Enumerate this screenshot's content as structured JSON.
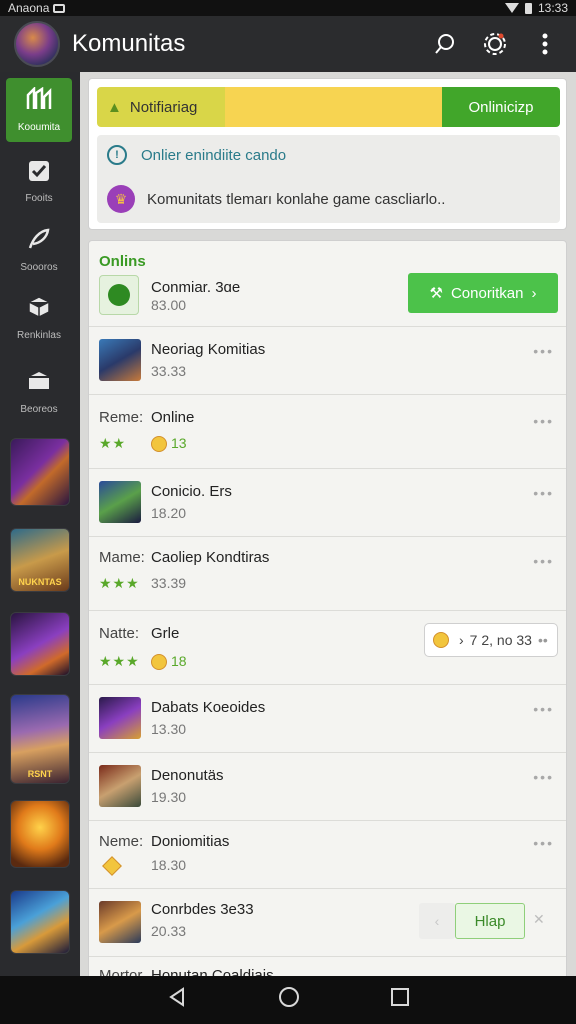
{
  "status": {
    "carrier": "Anaona",
    "time": "13:33"
  },
  "appbar": {
    "title": "Komunitas"
  },
  "sidebar": {
    "items": [
      {
        "label": "Kooumita"
      },
      {
        "label": "Fooits"
      },
      {
        "label": "Soooros"
      },
      {
        "label": "Renkinlas"
      },
      {
        "label": "Beoreos"
      }
    ],
    "thumb_captions": [
      "",
      "NUKNTAS",
      "",
      "RSNT",
      "",
      ""
    ]
  },
  "notification": {
    "warning_label": "Notifiariag",
    "online_button": "Onlinicizp",
    "line1": "Onlier enindiite cando",
    "line2": "Komunitats tlemarı konlahe game cascliarlo.."
  },
  "list": {
    "title": "Onlins",
    "connect_button": "Conoritkan",
    "help_button": "Hlap",
    "rows": [
      {
        "name": "Conmiar. 3ɑe",
        "sub": "83.00"
      },
      {
        "name": "Neoriag Komitias",
        "sub": "33.33"
      },
      {
        "prefix": "Reme:",
        "name": "Online",
        "rating": "★★",
        "value": "13"
      },
      {
        "name": "Conicio. Ers",
        "sub": "18.20"
      },
      {
        "prefix": "Mame:",
        "name": "Caoliep Kondtiras",
        "rating": "★★★",
        "value": "33.39"
      },
      {
        "prefix": "Natte:",
        "name": "Grle",
        "rating": "★★★",
        "value": "18",
        "pill": "7 2, no 33"
      },
      {
        "name": "Dabats Koeoides",
        "sub": "13.30"
      },
      {
        "name": "Denonutäs",
        "sub": "19.30"
      },
      {
        "prefix": "Neme:",
        "name": "Doniomitias",
        "sub": "18.30"
      },
      {
        "name": "Conrbdes 3e33",
        "sub": "20.33"
      },
      {
        "prefix": "Mortor",
        "name": "Honutan Coaldiais"
      }
    ]
  },
  "colors": {
    "accent_green": "#41a62a",
    "warning_yellow": "#f7d451",
    "sidebar_bg": "#2a2b2e",
    "appbar_bg": "#2b2c2e"
  },
  "icons": {
    "appbar": [
      "search-icon",
      "settings-icon",
      "more-vert-icon"
    ],
    "nav": [
      "back-icon",
      "home-icon",
      "recents-icon"
    ]
  }
}
